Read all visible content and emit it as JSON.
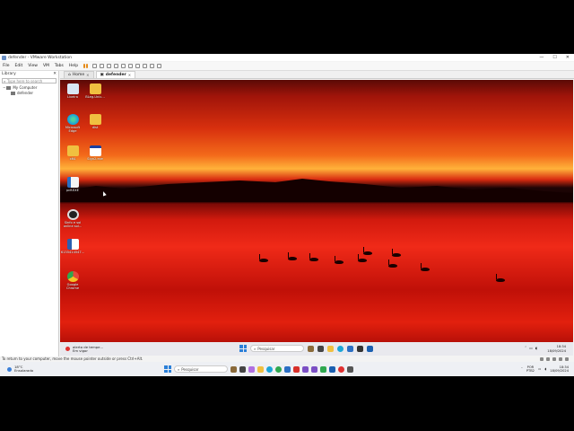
{
  "window": {
    "title": "defender - VMware Workstation",
    "controls": [
      "—",
      "☐",
      "✕"
    ]
  },
  "menu": {
    "items": [
      "File",
      "Edit",
      "View",
      "VM",
      "Tabs",
      "Help"
    ]
  },
  "library": {
    "header": "Library",
    "close": "✕",
    "search_placeholder": "Type here to search",
    "tree": [
      {
        "label": "My Computer"
      },
      {
        "label": "defender"
      }
    ]
  },
  "tabs": [
    {
      "label": "Home",
      "active": false
    },
    {
      "label": "defender",
      "active": true
    }
  ],
  "guest": {
    "desktop_icons": [
      {
        "label": "Lixeira",
        "icon": "recycle-bin-icon",
        "color": "#d8e6f4"
      },
      {
        "label": "Microsoft Edge",
        "icon": "edge-icon",
        "color": "#1ba5d8"
      },
      {
        "label": "x64",
        "icon": "folder-icon",
        "color": "#f0c040"
      },
      {
        "label": "pdf.EXE",
        "icon": "exe-icon",
        "color": "#f4f4f4"
      },
      {
        "label": "Sinfo e sol online sol...",
        "icon": "app-icon",
        "color": "#222222"
      },
      {
        "label": "6135414547...",
        "icon": "word-doc-icon",
        "color": "#2b5fb0"
      },
      {
        "label": "Google Chrome",
        "icon": "chrome-icon",
        "color": "#e8483a"
      },
      {
        "label": "BLeg-Unic...",
        "icon": "folder-icon",
        "color": "#f0c040"
      },
      {
        "label": "dist",
        "icon": "folder-icon",
        "color": "#f0c040"
      },
      {
        "label": "Sign2.exe",
        "icon": "window-icon",
        "color": "#ffffff"
      }
    ],
    "taskbar": {
      "weather_line1": "alerta de tempe...",
      "weather_line2": "Em vigor",
      "search_label": "Pesquisar",
      "time": "18:34",
      "date": "18/09/2024"
    }
  },
  "status_bar": {
    "text": "To return to your computer, move the mouse pointer outside or press Ctrl+Alt."
  },
  "host_taskbar": {
    "weather_temp": "18°C",
    "weather_desc": "Ensolarado",
    "search_label": "Pesquisar",
    "lang_line1": "POR",
    "lang_line2": "PTB2",
    "time": "18:34",
    "date": "18/09/2024"
  }
}
